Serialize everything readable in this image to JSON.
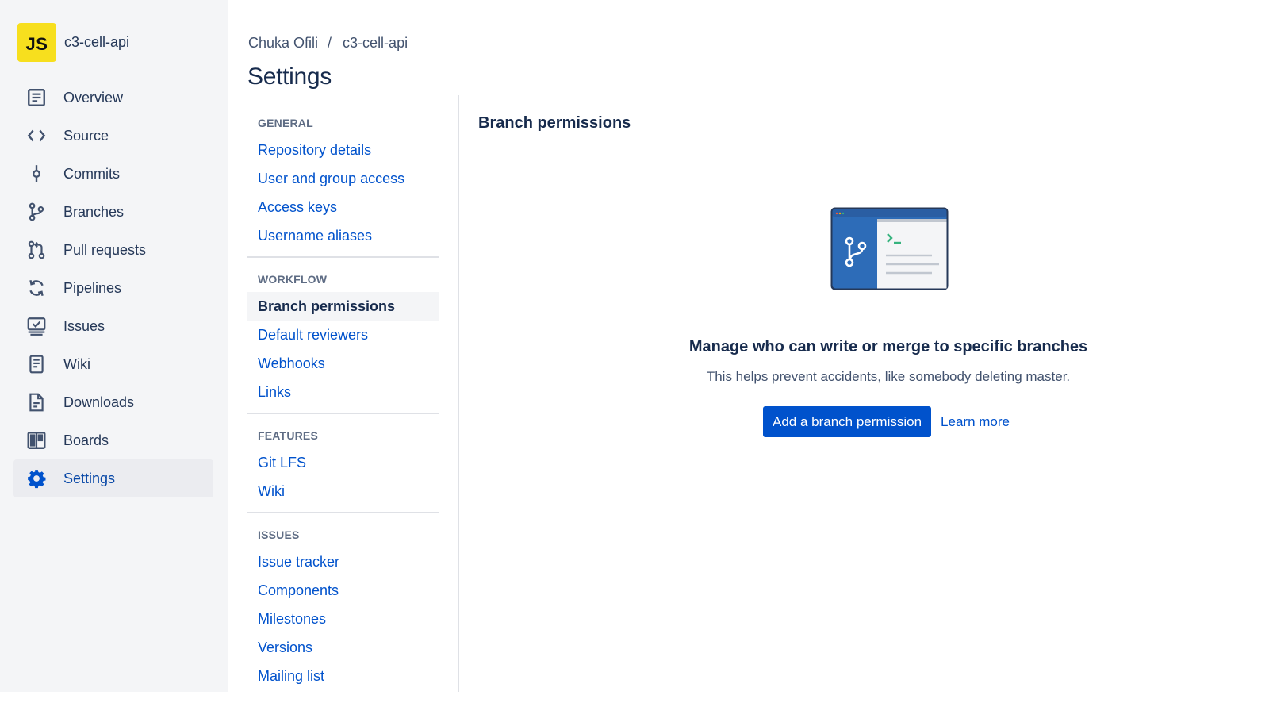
{
  "repo": {
    "avatar_text": "JS",
    "avatar_color": "#f7df1e",
    "name": "c3-cell-api"
  },
  "sidebar": {
    "items": [
      {
        "label": "Overview",
        "icon": "overview-icon"
      },
      {
        "label": "Source",
        "icon": "source-code-icon"
      },
      {
        "label": "Commits",
        "icon": "commit-icon"
      },
      {
        "label": "Branches",
        "icon": "branch-icon"
      },
      {
        "label": "Pull requests",
        "icon": "pull-request-icon"
      },
      {
        "label": "Pipelines",
        "icon": "pipelines-icon"
      },
      {
        "label": "Issues",
        "icon": "issues-icon"
      },
      {
        "label": "Wiki",
        "icon": "wiki-icon"
      },
      {
        "label": "Downloads",
        "icon": "downloads-icon"
      },
      {
        "label": "Boards",
        "icon": "boards-icon"
      },
      {
        "label": "Settings",
        "icon": "gear-icon",
        "active": true
      }
    ]
  },
  "breadcrumb": {
    "owner": "Chuka Ofili",
    "separator": "/",
    "repo": "c3-cell-api"
  },
  "page": {
    "title": "Settings"
  },
  "settings_nav": {
    "groups": [
      {
        "heading": "GENERAL",
        "links": [
          "Repository details",
          "User and group access",
          "Access keys",
          "Username aliases"
        ]
      },
      {
        "heading": "WORKFLOW",
        "links": [
          "Branch permissions",
          "Default reviewers",
          "Webhooks",
          "Links"
        ]
      },
      {
        "heading": "FEATURES",
        "links": [
          "Git LFS",
          "Wiki"
        ]
      },
      {
        "heading": "ISSUES",
        "links": [
          "Issue tracker",
          "Components",
          "Milestones",
          "Versions",
          "Mailing list"
        ]
      }
    ],
    "active": "Branch permissions"
  },
  "panel": {
    "title": "Branch permissions",
    "empty_heading": "Manage who can write or merge to specific branches",
    "empty_description": "This helps prevent accidents, like somebody deleting master.",
    "primary_button": "Add a branch permission",
    "learn_more": "Learn more",
    "illustration_icon": "branch-terminal-illustration"
  },
  "colors": {
    "sidebar_bg": "#f4f5f7",
    "link": "#0052cc",
    "primary_button": "#0052cc",
    "text": "#172b4d"
  }
}
